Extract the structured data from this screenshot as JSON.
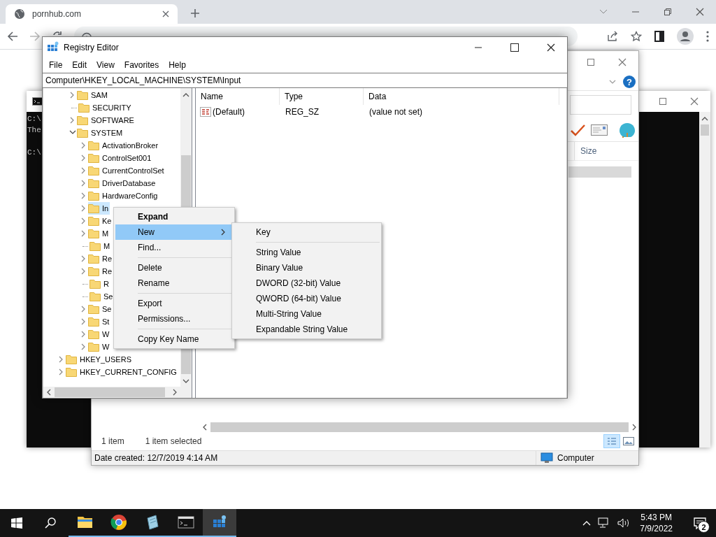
{
  "browser": {
    "tab": {
      "title": "pornhub.com",
      "selected": true
    }
  },
  "explorer": {
    "help": "?",
    "columns": [
      "Size"
    ],
    "item_count": "1 item",
    "selection": "1 item selected",
    "details": "Date created: 12/7/2019 4:14 AM",
    "zone": "Computer"
  },
  "console": {
    "blocks": [
      [
        "C:\\",
        "The"
      ],
      [
        "C:\\"
      ]
    ]
  },
  "registry": {
    "title": "Registry Editor",
    "menu": [
      "File",
      "Edit",
      "View",
      "Favorites",
      "Help"
    ],
    "address": "Computer\\HKEY_LOCAL_MACHINE\\SYSTEM\\Input",
    "tree": [
      {
        "children": [
          {
            "label": "SAM",
            "expandable": true,
            "expanded": false,
            "selected": false
          },
          {
            "label": "SECURITY",
            "expandable": false,
            "selected": false
          },
          {
            "label": "SOFTWARE",
            "expandable": true,
            "expanded": false,
            "selected": false
          },
          {
            "label": "SYSTEM",
            "expandable": true,
            "expanded": true,
            "selected": false,
            "children": [
              {
                "label": "ActivationBroker",
                "expandable": true,
                "expanded": false,
                "selected": false
              },
              {
                "label": "ControlSet001",
                "expandable": true,
                "expanded": false,
                "selected": false
              },
              {
                "label": "CurrentControlSet",
                "expandable": true,
                "expanded": false,
                "selected": false
              },
              {
                "label": "DriverDatabase",
                "expandable": true,
                "expanded": false,
                "selected": false
              },
              {
                "label": "HardwareConfig",
                "expandable": true,
                "expanded": false,
                "selected": false
              },
              {
                "label": "In",
                "expandable": true,
                "expanded": false,
                "selected": true
              },
              {
                "label": "Ke",
                "expandable": true,
                "expanded": false,
                "selected": false
              },
              {
                "label": "M",
                "expandable": true,
                "expanded": false,
                "selected": false
              },
              {
                "label": "M",
                "expandable": false,
                "selected": false
              },
              {
                "label": "Re",
                "expandable": true,
                "expanded": false,
                "selected": false
              },
              {
                "label": "Re",
                "expandable": true,
                "expanded": false,
                "selected": false
              },
              {
                "label": "R",
                "expandable": false,
                "selected": false
              },
              {
                "label": "Se",
                "expandable": false,
                "selected": false
              },
              {
                "label": "Se",
                "expandable": true,
                "expanded": false,
                "selected": false
              },
              {
                "label": "St",
                "expandable": true,
                "expanded": false,
                "selected": false
              },
              {
                "label": "W",
                "expandable": true,
                "expanded": false,
                "selected": false
              },
              {
                "label": "W",
                "expandable": true,
                "expanded": false,
                "selected": false
              }
            ]
          }
        ]
      },
      {
        "label": "HKEY_USERS",
        "expandable": true,
        "expanded": false,
        "selected": false
      },
      {
        "label": "HKEY_CURRENT_CONFIG",
        "expandable": true,
        "expanded": false,
        "selected": false
      }
    ],
    "columns": [
      "Name",
      "Type",
      "Data"
    ],
    "values": [
      {
        "name": "(Default)",
        "type": "REG_SZ",
        "data": "(value not set)"
      }
    ],
    "context_menu": [
      {
        "kind": "item",
        "label": "Expand",
        "default": true,
        "selected": false,
        "submenu": false
      },
      {
        "kind": "item",
        "label": "New",
        "default": false,
        "selected": true,
        "submenu": true
      },
      {
        "kind": "item",
        "label": "Find...",
        "default": false,
        "selected": false,
        "submenu": false
      },
      {
        "kind": "separator"
      },
      {
        "kind": "item",
        "label": "Delete",
        "default": false,
        "selected": false,
        "submenu": false
      },
      {
        "kind": "item",
        "label": "Rename",
        "default": false,
        "selected": false,
        "submenu": false
      },
      {
        "kind": "separator"
      },
      {
        "kind": "item",
        "label": "Export",
        "default": false,
        "selected": false,
        "submenu": false
      },
      {
        "kind": "item",
        "label": "Permissions...",
        "default": false,
        "selected": false,
        "submenu": false
      },
      {
        "kind": "separator"
      },
      {
        "kind": "item",
        "label": "Copy Key Name",
        "default": false,
        "selected": false,
        "submenu": false
      }
    ],
    "submenu": [
      {
        "kind": "item",
        "label": "Key",
        "default": false,
        "selected": false,
        "submenu": false
      },
      {
        "kind": "separator"
      },
      {
        "kind": "item",
        "label": "String Value",
        "default": false,
        "selected": false,
        "submenu": false
      },
      {
        "kind": "item",
        "label": "Binary Value",
        "default": false,
        "selected": false,
        "submenu": false
      },
      {
        "kind": "item",
        "label": "DWORD (32-bit) Value",
        "default": false,
        "selected": false,
        "submenu": false
      },
      {
        "kind": "item",
        "label": "QWORD (64-bit) Value",
        "default": false,
        "selected": false,
        "submenu": false
      },
      {
        "kind": "item",
        "label": "Multi-String Value",
        "default": false,
        "selected": false,
        "submenu": false
      },
      {
        "kind": "item",
        "label": "Expandable String Value",
        "default": false,
        "selected": false,
        "submenu": false
      }
    ]
  },
  "taskbar": {
    "apps": [
      {
        "kind": "folder",
        "running": true,
        "selected": false
      },
      {
        "kind": "browser",
        "running": true,
        "selected": false
      },
      {
        "kind": "notepad",
        "running": true,
        "selected": false
      },
      {
        "kind": "console",
        "running": true,
        "selected": false
      },
      {
        "kind": "registry",
        "running": true,
        "selected": true
      }
    ],
    "time": "5:43 PM",
    "date": "7/9/2022",
    "notifications": "2"
  }
}
